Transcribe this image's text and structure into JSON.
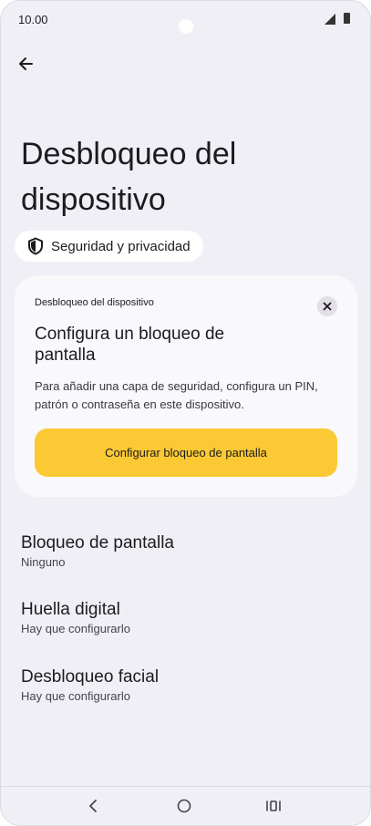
{
  "status": {
    "time": "10.00"
  },
  "page": {
    "title": "Desbloqueo del dispositivo"
  },
  "chip": {
    "label": "Seguridad y privacidad",
    "icon": "shield-icon"
  },
  "card": {
    "small_title": "Desbloqueo del dispositivo",
    "title": "Configura un bloqueo de pantalla",
    "description": "Para añadir una capa de seguridad, configura un PIN, patrón o contraseña en este dispositivo.",
    "button_label": "Configurar bloqueo de pantalla",
    "accent_color": "#fbc934"
  },
  "items": [
    {
      "title": "Bloqueo de pantalla",
      "subtitle": "Ninguno"
    },
    {
      "title": "Huella digital",
      "subtitle": "Hay que configurarlo"
    },
    {
      "title": "Desbloqueo facial",
      "subtitle": "Hay que configurarlo"
    }
  ]
}
